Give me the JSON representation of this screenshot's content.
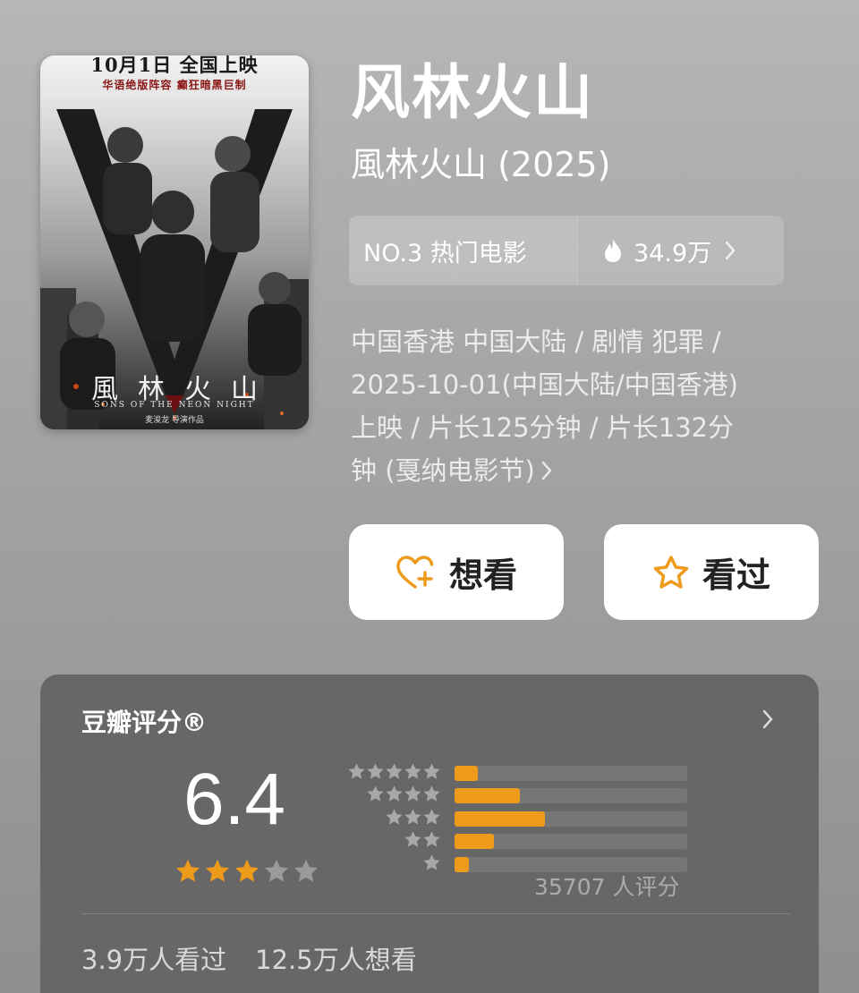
{
  "poster": {
    "banner": "10月1日  全国上映",
    "tagline": "华语绝版阵容  癫狂暗黑巨制",
    "title_cn": "風林火山",
    "title_en": "SONS OF THE NEON NIGHT",
    "director": "麦浚龙 导演作品"
  },
  "movie": {
    "title": "风林火山",
    "original_title": "風林火山 (2025)"
  },
  "rank": {
    "label": "NO.3 热门电影",
    "heat": "34.9万"
  },
  "meta": {
    "line1": "中国香港 中国大陆 / 剧情 犯罪 /",
    "line2": "2025-10-01(中国大陆/中国香港)",
    "line3": "上映 / 片长125分钟 / 片长132分",
    "line4": "钟 (戛纳电影节)"
  },
  "actions": {
    "want_label": "想看",
    "seen_label": "看过"
  },
  "rating": {
    "title": "豆瓣评分®",
    "score": "6.4",
    "stars": 3,
    "distribution": [
      {
        "stars": 5,
        "fraction": 0.1
      },
      {
        "stars": 4,
        "fraction": 0.28
      },
      {
        "stars": 3,
        "fraction": 0.39
      },
      {
        "stars": 2,
        "fraction": 0.17
      },
      {
        "stars": 1,
        "fraction": 0.06
      }
    ],
    "count_text": "35707 人评分",
    "watched": "3.9万人看过",
    "wanted": "12.5万人想看"
  },
  "colors": {
    "accent": "#ee9b1c",
    "star_inactive": "#9a9a9a"
  },
  "icons": {
    "hot": "flame-icon",
    "want": "heart-plus-icon",
    "seen": "star-outline-icon",
    "more": "chevron-right-icon"
  }
}
